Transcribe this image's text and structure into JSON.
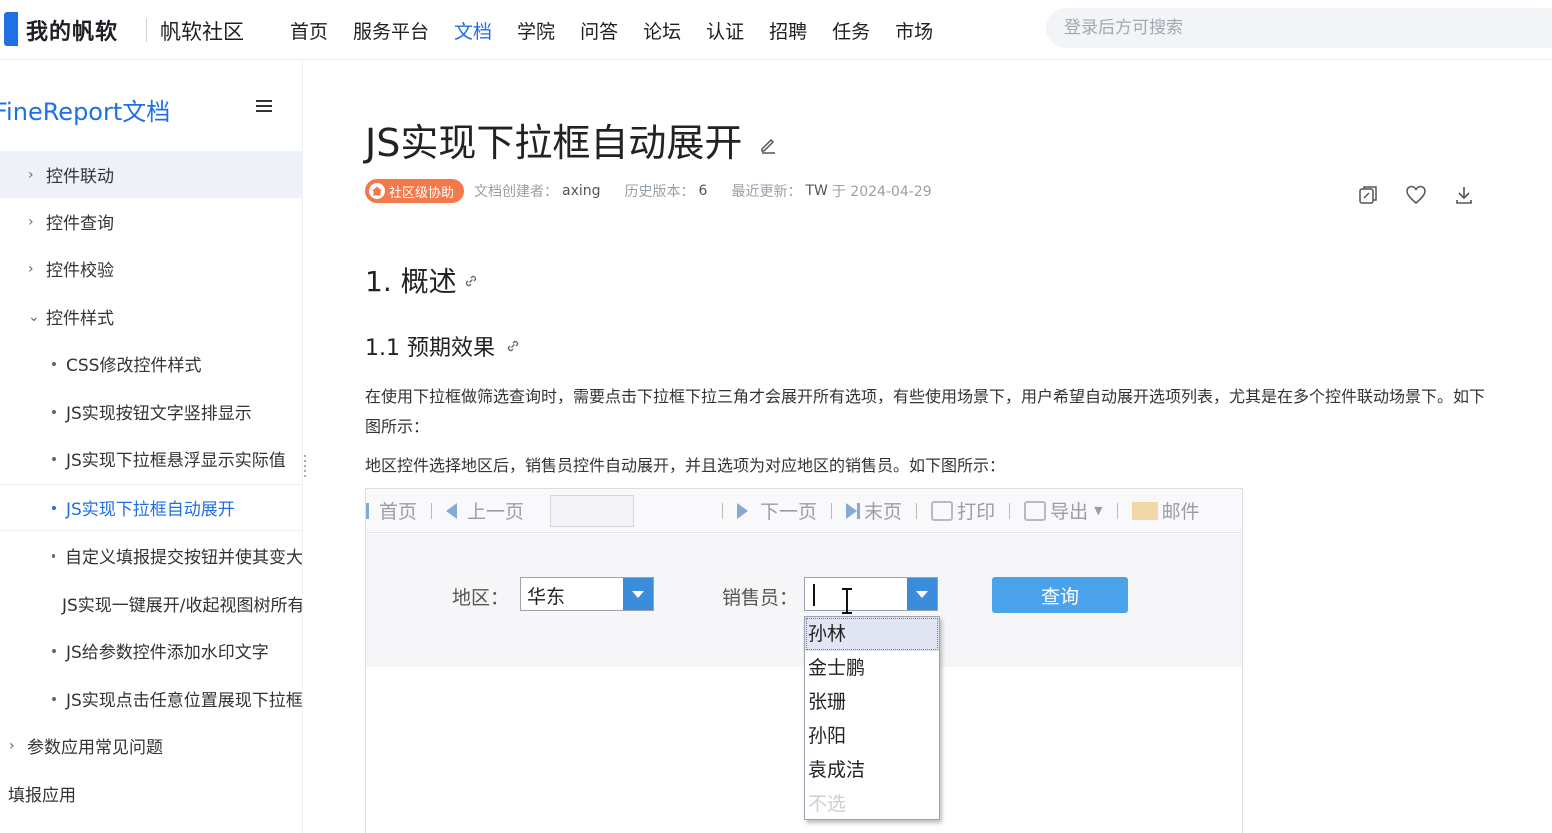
{
  "brand": {
    "logo_text": "我的帆软",
    "community": "帆软社区"
  },
  "nav": {
    "items": [
      "首页",
      "服务平台",
      "文档",
      "学院",
      "问答",
      "论坛",
      "认证",
      "招聘",
      "任务",
      "市场"
    ],
    "active_index": 2
  },
  "search": {
    "placeholder": "登录后方可搜索"
  },
  "sidebar": {
    "title": "FineReport文档",
    "items": [
      {
        "label": "控件联动",
        "level": 1,
        "chevron": "›"
      },
      {
        "label": "控件查询",
        "level": 1,
        "chevron": "›"
      },
      {
        "label": "控件校验",
        "level": 1,
        "chevron": "›"
      },
      {
        "label": "控件样式",
        "level": 1,
        "chevron": "⌄"
      },
      {
        "label": "CSS修改控件样式",
        "level": 2
      },
      {
        "label": "JS实现按钮文字竖排显示",
        "level": 2
      },
      {
        "label": "JS实现下拉框悬浮显示实际值",
        "level": 2
      },
      {
        "label": "JS实现下拉框自动展开",
        "level": 2
      },
      {
        "label": "自定义填报提交按钮并使其变大",
        "level": 2
      },
      {
        "label": "JS实现一键展开/收起视图树所有",
        "level": 2
      },
      {
        "label": "JS给参数控件添加水印文字",
        "level": 2
      },
      {
        "label": "JS实现点击任意位置展现下拉框",
        "level": 2
      },
      {
        "label": "参数应用常见问题",
        "level": 0,
        "chevron": "›"
      },
      {
        "label": "填报应用",
        "level": 0
      }
    ]
  },
  "article": {
    "title": "JS实现下拉框自动展开",
    "badge": "社区级协助",
    "creator_label": "文档创建者：",
    "creator": "axing",
    "history_label": "历史版本：",
    "history": "6",
    "updated_label": "最近更新：",
    "updated_by": "TW",
    "updated_at": "于 2024-04-29",
    "section1": "1. 概述",
    "section1_1": "1.1 预期效果",
    "para1": "在使用下拉框做筛选查询时，需要点击下拉框下拉三角才会展开所有选项，有些使用场景下，用户希望自动展开选项列表，尤其是在多个控件联动场景下。如下图所示：",
    "para2": "地区控件选择地区后，销售员控件自动展开，并且选项为对应地区的销售员。如下图所示："
  },
  "demo": {
    "toolbar": {
      "first": "首页",
      "prev": "上一页",
      "next": "下一页",
      "last": "末页",
      "print": "打印",
      "export": "导出",
      "mail": "邮件"
    },
    "region_label": "地区：",
    "region_value": "华东",
    "sales_label": "销售员：",
    "query_button": "查询",
    "options": [
      "孙林",
      "金士鹏",
      "张珊",
      "孙阳",
      "袁成洁",
      "不选"
    ]
  },
  "colors": {
    "accent": "#1f6fe5",
    "badge": "#f3784a",
    "combo_arrow": "#3b8ddb",
    "query": "#4aa3ea"
  }
}
